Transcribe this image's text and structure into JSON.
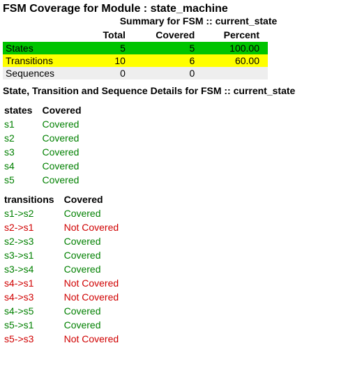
{
  "module_title": "FSM Coverage for Module : state_machine",
  "summary_title": "Summary for FSM :: current_state",
  "summary_headers": {
    "total": "Total",
    "covered": "Covered",
    "percent": "Percent"
  },
  "summary_rows": {
    "states": {
      "label": "States",
      "total": "5",
      "covered": "5",
      "percent": "100.00"
    },
    "transitions": {
      "label": "Transitions",
      "total": "10",
      "covered": "6",
      "percent": "60.00"
    },
    "sequences": {
      "label": "Sequences",
      "total": "0",
      "covered": "0",
      "percent": ""
    }
  },
  "details_title": "State, Transition and Sequence Details for FSM :: current_state",
  "states_table": {
    "header_name": "states",
    "header_cov": "Covered",
    "rows": [
      {
        "name": "s1",
        "status": "Covered",
        "cls": "covered"
      },
      {
        "name": "s2",
        "status": "Covered",
        "cls": "covered"
      },
      {
        "name": "s3",
        "status": "Covered",
        "cls": "covered"
      },
      {
        "name": "s4",
        "status": "Covered",
        "cls": "covered"
      },
      {
        "name": "s5",
        "status": "Covered",
        "cls": "covered"
      }
    ]
  },
  "transitions_table": {
    "header_name": "transitions",
    "header_cov": "Covered",
    "rows": [
      {
        "name": "s1->s2",
        "status": "Covered",
        "cls": "covered"
      },
      {
        "name": "s2->s1",
        "status": "Not Covered",
        "cls": "notcovered"
      },
      {
        "name": "s2->s3",
        "status": "Covered",
        "cls": "covered"
      },
      {
        "name": "s3->s1",
        "status": "Covered",
        "cls": "covered"
      },
      {
        "name": "s3->s4",
        "status": "Covered",
        "cls": "covered"
      },
      {
        "name": "s4->s1",
        "status": "Not Covered",
        "cls": "notcovered"
      },
      {
        "name": "s4->s3",
        "status": "Not Covered",
        "cls": "notcovered"
      },
      {
        "name": "s4->s5",
        "status": "Covered",
        "cls": "covered"
      },
      {
        "name": "s5->s1",
        "status": "Covered",
        "cls": "covered"
      },
      {
        "name": "s5->s3",
        "status": "Not Covered",
        "cls": "notcovered"
      }
    ]
  }
}
